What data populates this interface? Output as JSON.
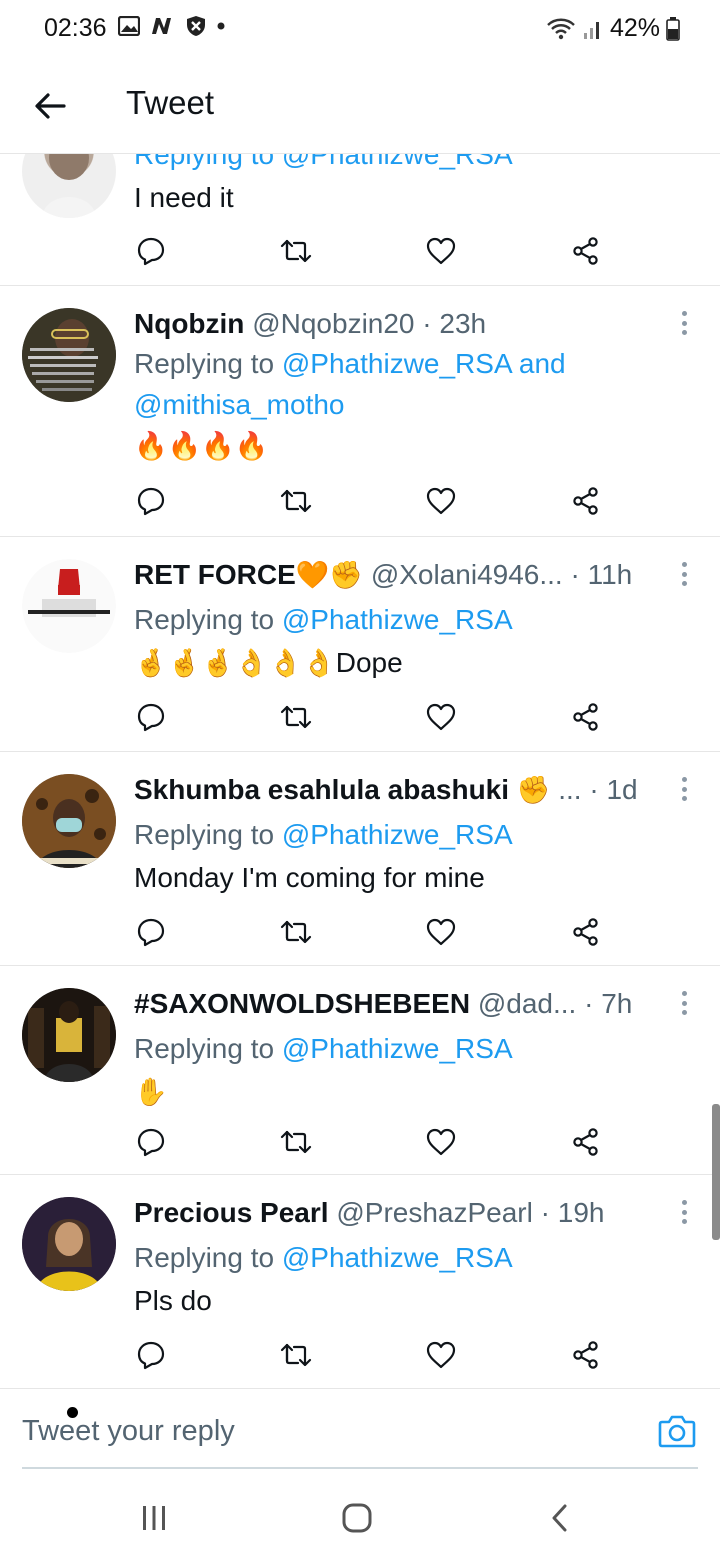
{
  "status_bar": {
    "time": "02:36",
    "battery": "42%",
    "left_icons": [
      "gallery-icon",
      "news-icon",
      "shield-icon",
      "dot-icon"
    ],
    "right_icons": [
      "wifi-icon",
      "signal-icon",
      "battery-icon"
    ]
  },
  "header": {
    "title": "Tweet"
  },
  "tweets": [
    {
      "replying_prefix": "",
      "replying_text": "Replying to @Phathizwe_RSA",
      "body": "I need it"
    },
    {
      "name": "Nqobzin",
      "handle": "@Nqobzin20",
      "time": "· 23h",
      "replying_prefix": "Replying to ",
      "mention_1": "@Phathizwe_RSA",
      "and": " and",
      "mention_2": "@mithisa_motho",
      "body": "🔥🔥🔥🔥"
    },
    {
      "name": "RET FORCE",
      "name_emojis": "🧡✊",
      "handle": "@Xolani4946...",
      "time": "· 11h",
      "replying_prefix": "Replying to ",
      "mention_1": "@Phathizwe_RSA",
      "body_emojis": "🤞🤞🤞👌👌👌",
      "body": "Dope"
    },
    {
      "name": "Skhumba esahlula abashuki",
      "name_emojis": "✊",
      "handle": "...",
      "time": "· 1d",
      "replying_prefix": "Replying to ",
      "mention_1": "@Phathizwe_RSA",
      "body": "Monday I'm coming for mine"
    },
    {
      "name": "#SAXONWOLDSHEBEEN",
      "handle": "@dad...",
      "time": "· 7h",
      "replying_prefix": "Replying to ",
      "mention_1": "@Phathizwe_RSA",
      "body": "✋"
    },
    {
      "name": "Precious Pearl",
      "handle": "@PreshazPearl",
      "time": "· 19h",
      "replying_prefix": "Replying to ",
      "mention_1": "@Phathizwe_RSA",
      "body": "Pls do"
    }
  ],
  "reply_bar": {
    "placeholder": "Tweet your reply"
  },
  "colors": {
    "accent": "#1d9bf0",
    "text": "#0f1419",
    "secondary": "#536471",
    "divider": "#e6e6e6"
  }
}
